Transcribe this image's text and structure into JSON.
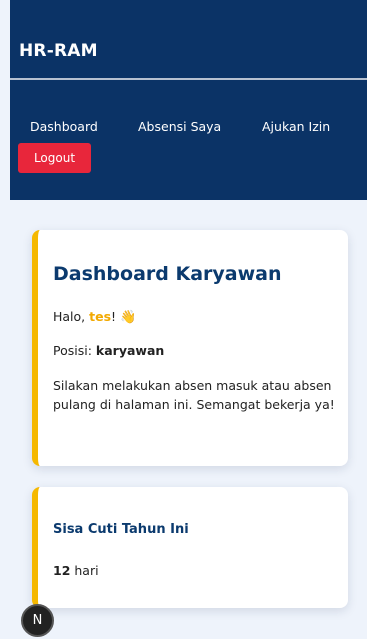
{
  "brand": "HR-RAM",
  "nav": {
    "dashboard": "Dashboard",
    "attendance": "Absensi Saya",
    "leave_request": "Ajukan Izin",
    "logout": "Logout"
  },
  "main_card": {
    "title": "Dashboard Karyawan",
    "greeting_prefix": "Halo, ",
    "username": "tes",
    "greeting_suffix": "!",
    "wave": "👋",
    "position_label": "Posisi: ",
    "position_value": "karyawan",
    "message": "Silakan melakukan absen masuk atau absen pulang di halaman ini. Semangat bekerja ya!"
  },
  "leave_card": {
    "title": "Sisa Cuti Tahun Ini",
    "count": "12",
    "unit": " hari"
  },
  "dev_badge": "N",
  "colors": {
    "navbar": "#0b3366",
    "accent": "#f5b800",
    "logout": "#e8263b",
    "title": "#0b3a6e",
    "background": "#eef3fb"
  }
}
